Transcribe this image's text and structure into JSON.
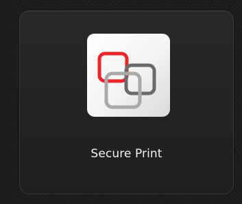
{
  "tile": {
    "label": "Secure Print",
    "icon": "secure-print-overlapping-squares-icon",
    "colors": {
      "accent_red": "#e8262b",
      "dark_gray": "#6a6a6a",
      "light_gray": "#a9a9a9",
      "icon_background": "#f4f4f4"
    }
  }
}
